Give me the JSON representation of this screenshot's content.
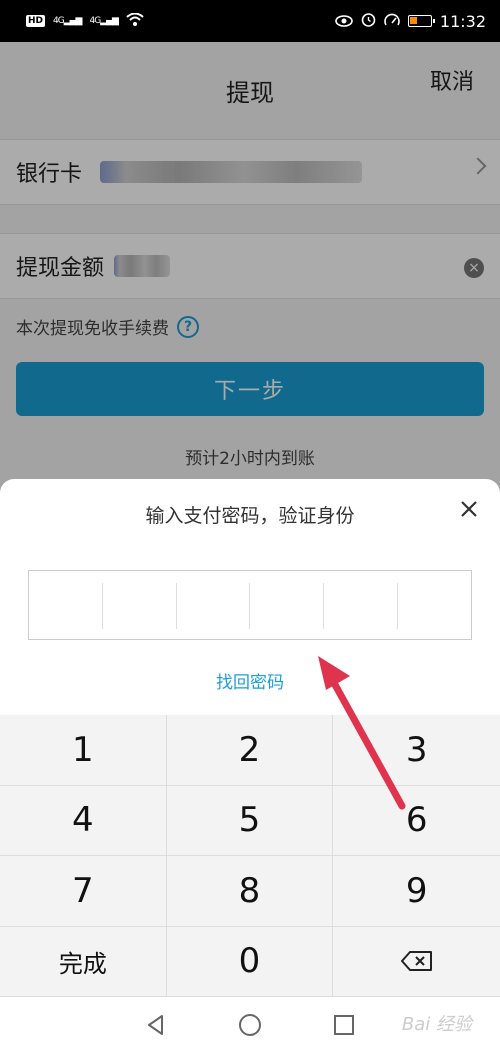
{
  "status_bar": {
    "time": "11:32",
    "net1": "HD",
    "sig1": "4G",
    "sig2": "4G"
  },
  "page": {
    "title": "提现",
    "cancel_label": "取消",
    "bank_label": "银行卡",
    "amount_label": "提现金额",
    "fee_text": "本次提现免收手续费",
    "next_button": "下一步",
    "eta_text": "预计2小时内到账"
  },
  "sheet": {
    "title": "输入支付密码，验证身份",
    "close_label": "×",
    "forgot_link": "找回密码",
    "pin_length": 6
  },
  "keypad": {
    "keys": [
      "1",
      "2",
      "3",
      "4",
      "5",
      "6",
      "7",
      "8",
      "9"
    ],
    "done_label": "完成",
    "zero_label": "0"
  },
  "watermark": "Bai 经验",
  "colors": {
    "accent": "#1a9fd4",
    "arrow": "#e0334d"
  },
  "icons": [
    "eye-icon",
    "alarm-icon",
    "speed-icon",
    "battery-icon",
    "wifi-icon",
    "chevron-right-icon",
    "clear-icon",
    "help-icon",
    "close-icon",
    "backspace-icon",
    "back-icon",
    "home-icon",
    "recents-icon"
  ]
}
